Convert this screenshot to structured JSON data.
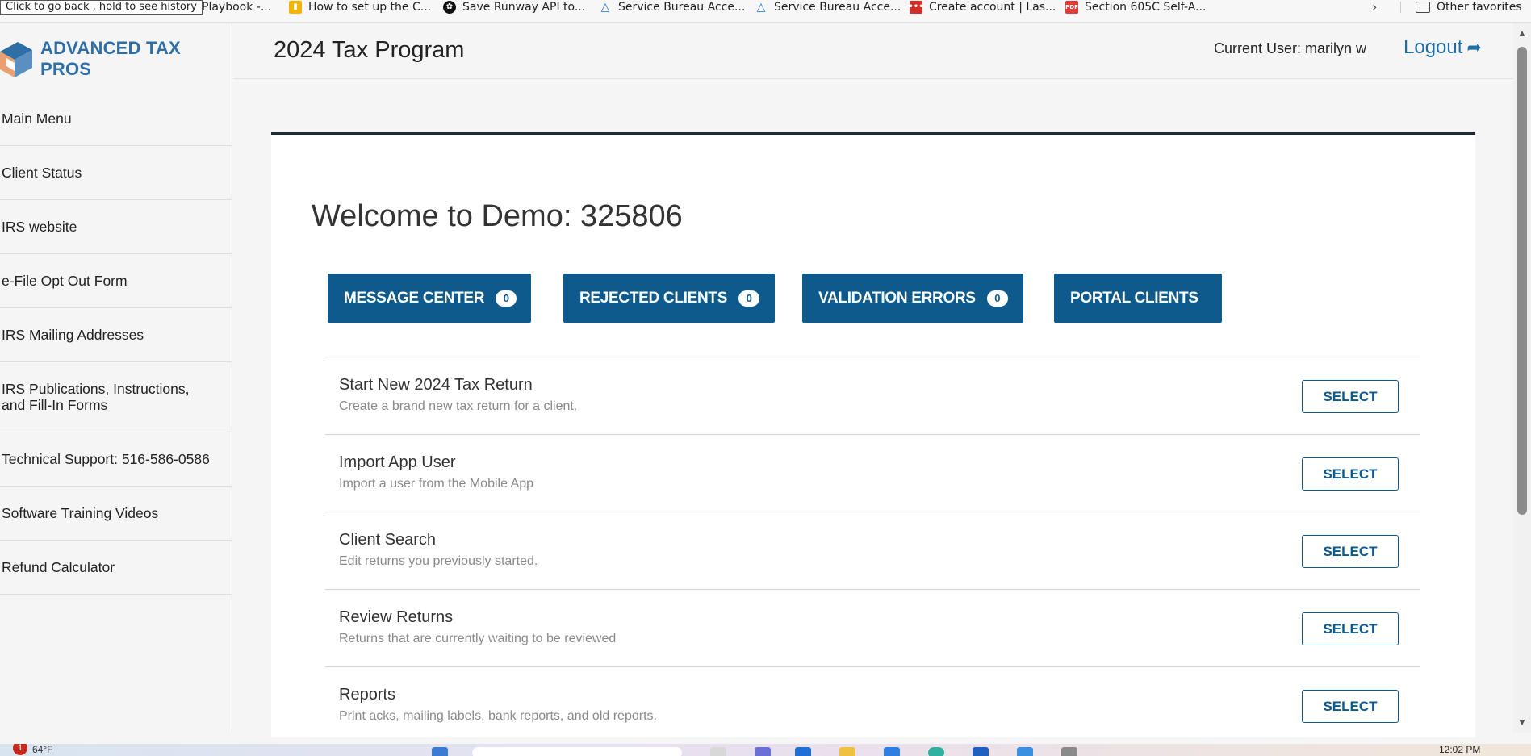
{
  "browser": {
    "tooltip": "Click to go back , hold to see history",
    "bookmarks": [
      {
        "label": "Playbook -...",
        "icon": "page-icon",
        "color": "#ffffff"
      },
      {
        "label": "How to set up the C...",
        "icon": "google-icon",
        "color": "#f4b400"
      },
      {
        "label": "Save Runway API to...",
        "icon": "openai-icon",
        "color": "#111111"
      },
      {
        "label": "Service Bureau Acce...",
        "icon": "triangle-icon",
        "color": "#1a73e8"
      },
      {
        "label": "Service Bureau Acce...",
        "icon": "triangle-icon",
        "color": "#1a73e8"
      },
      {
        "label": "Create account | Las...",
        "icon": "lastpass-icon",
        "color": "#d32d27"
      },
      {
        "label": "Section 605C Self-A...",
        "icon": "pdf-icon",
        "color": "#e53935"
      }
    ],
    "other_favorites": "Other favorites"
  },
  "sidebar": {
    "logo_text": "ADVANCED TAX PROS",
    "items": [
      {
        "label": "Main Menu"
      },
      {
        "label": "Client Status"
      },
      {
        "label": "IRS website"
      },
      {
        "label": "e-File Opt Out Form"
      },
      {
        "label": "IRS Mailing Addresses"
      },
      {
        "label": "IRS Publications, Instructions, and Fill-In Forms"
      },
      {
        "label": "Technical Support: 516-586-0586"
      },
      {
        "label": "Software Training Videos"
      },
      {
        "label": "Refund Calculator"
      }
    ]
  },
  "header": {
    "title": "2024 Tax Program",
    "current_user": "Current User: marilyn w",
    "logout": "Logout"
  },
  "main": {
    "welcome": "Welcome to Demo: 325806",
    "quick_buttons": [
      {
        "label": "MESSAGE CENTER",
        "badge": "0"
      },
      {
        "label": "REJECTED CLIENTS",
        "badge": "0"
      },
      {
        "label": "VALIDATION ERRORS",
        "badge": "0"
      },
      {
        "label": "PORTAL CLIENTS",
        "badge": null
      }
    ],
    "options": [
      {
        "title": "Start New 2024 Tax Return",
        "desc": "Create a brand new tax return for a client.",
        "button": "SELECT"
      },
      {
        "title": "Import App User",
        "desc": "Import a user from the Mobile App",
        "button": "SELECT"
      },
      {
        "title": "Client Search",
        "desc": "Edit returns you previously started.",
        "button": "SELECT"
      },
      {
        "title": "Review Returns",
        "desc": "Returns that are currently waiting to be reviewed",
        "button": "SELECT"
      },
      {
        "title": "Reports",
        "desc": "Print acks, mailing labels, bank reports, and old reports.",
        "button": "SELECT"
      }
    ]
  },
  "taskbar": {
    "weather": "64°F",
    "alert_count": "1",
    "clock": "12:02 PM"
  },
  "colors": {
    "primary": "#0f5a8c",
    "logo_blue": "#2f6fa6",
    "card_border": "#1d2a3a"
  }
}
